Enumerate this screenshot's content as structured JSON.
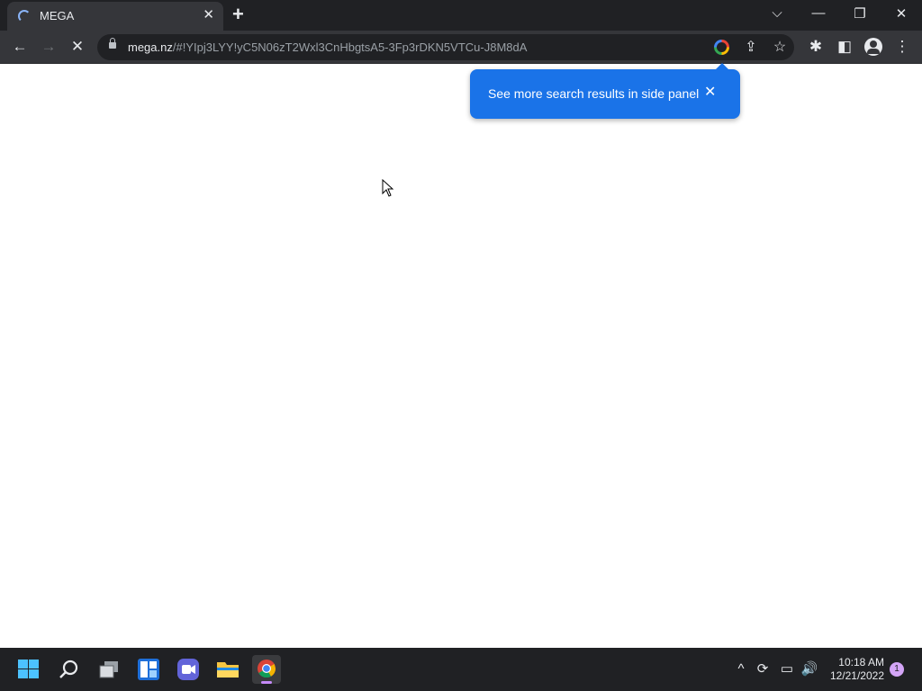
{
  "browser": {
    "tab": {
      "title": "MEGA",
      "close_glyph": "✕"
    },
    "new_tab_glyph": "+",
    "window_controls": {
      "tab_search_glyph": "⌵",
      "minimize_glyph": "—",
      "restore_glyph": "❐",
      "close_glyph": "✕"
    },
    "nav": {
      "back_glyph": "←",
      "forward_glyph": "→",
      "stop_glyph": "✕"
    },
    "omnibox": {
      "url_host": "mega.nz",
      "url_path": "/#!YIpj3LYY!yC5N06zT2Wxl3CnHbgtsA5-3Fp3rDKN5VTCu-J8M8dA",
      "share_glyph": "⇪",
      "bookmark_glyph": "☆"
    },
    "toolbar_right": {
      "extensions_glyph": "✱",
      "side_panel_glyph": "◧",
      "menu_glyph": "⋮"
    }
  },
  "bubble": {
    "text": "See more search results in side panel",
    "close_glyph": "✕",
    "color": "#1a73e8"
  },
  "taskbar": {
    "apps": [
      "start-icon",
      "search-icon",
      "task-view-icon",
      "widgets-icon",
      "teams-chat-icon",
      "file-explorer-icon",
      "chrome-icon"
    ],
    "tray": {
      "overflow_glyph": "^",
      "sync_glyph": "⟳",
      "network_glyph": "▭",
      "volume_glyph": "🔊"
    },
    "time": "10:18 AM",
    "date": "12/21/2022",
    "notification_count": "1"
  },
  "colors": {
    "tabstrip": "#202124",
    "toolbar": "#35363a",
    "accent": "#1a73e8"
  }
}
